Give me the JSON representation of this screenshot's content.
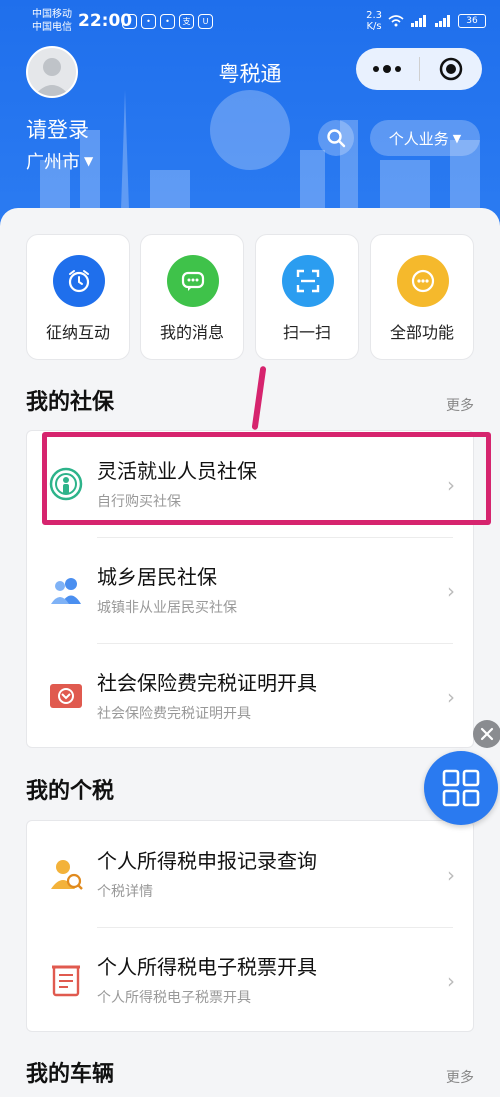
{
  "status_bar": {
    "carrier_1": "中国移动",
    "carrier_2": "中国电信",
    "time": "22:00",
    "net_speed": "2.3",
    "net_unit": "K/s",
    "battery": "36"
  },
  "nav": {
    "title": "粤税通"
  },
  "profile": {
    "login_text": "请登录",
    "city": "广州市"
  },
  "header_actions": {
    "business_label": "个人业务"
  },
  "quick_actions": [
    {
      "label": "征纳互动",
      "icon": "alarm-clock-icon",
      "color": "#1f6fec"
    },
    {
      "label": "我的消息",
      "icon": "chat-bubble-icon",
      "color": "#3fc24a"
    },
    {
      "label": "扫一扫",
      "icon": "scan-icon",
      "color": "#2b9df0"
    },
    {
      "label": "全部功能",
      "icon": "more-dots-icon",
      "color": "#f5b92c"
    }
  ],
  "social_insurance": {
    "title": "我的社保",
    "more": "更多",
    "items": [
      {
        "title": "灵活就业人员社保",
        "subtitle": "自行购买社保",
        "icon": "flexible-worker-icon"
      },
      {
        "title": "城乡居民社保",
        "subtitle": "城镇非从业居民买社保",
        "icon": "residents-icon"
      },
      {
        "title": "社会保险费完税证明开具",
        "subtitle": "社会保险费完税证明开具",
        "icon": "insurance-certificate-icon"
      }
    ]
  },
  "personal_tax": {
    "title": "我的个税",
    "items": [
      {
        "title": "个人所得税申报记录查询",
        "subtitle": "个税详情",
        "icon": "tax-record-icon"
      },
      {
        "title": "个人所得税电子税票开具",
        "subtitle": "个人所得税电子税票开具",
        "icon": "tax-receipt-icon"
      }
    ]
  },
  "vehicles": {
    "title": "我的车辆",
    "more": "更多"
  },
  "colors": {
    "brand": "#1f6fec",
    "highlight": "#d6246e"
  }
}
